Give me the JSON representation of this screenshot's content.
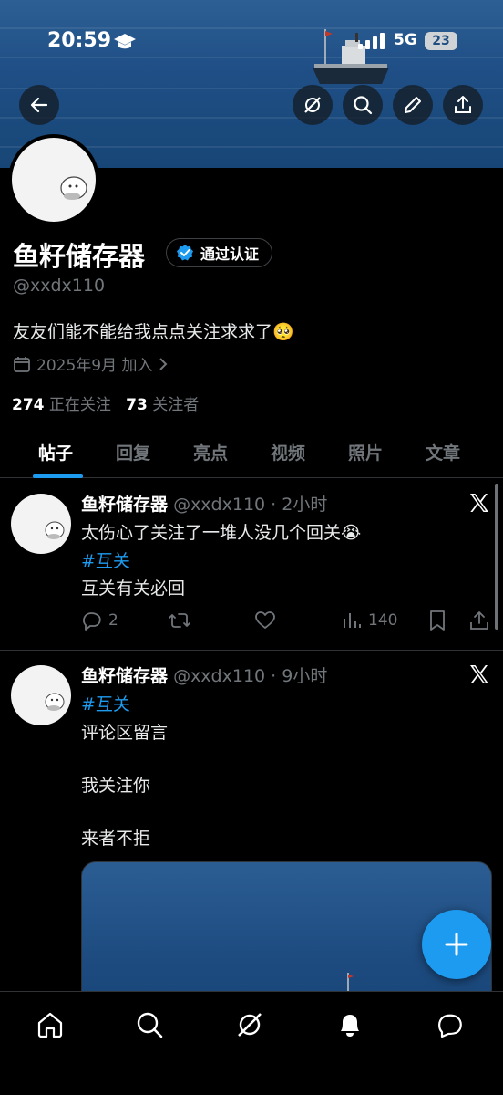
{
  "status_bar": {
    "time": "20:59",
    "network": "5G",
    "battery": "23"
  },
  "header": {
    "back_icon": "arrow-left-icon",
    "actions": [
      "grok-icon",
      "search-icon",
      "edit-icon",
      "share-icon"
    ]
  },
  "profile": {
    "name": "鱼籽储存器",
    "verified_label": "通过认证",
    "handle": "@xxdx110",
    "bio": "友友们能不能给我点点关注求求了🥺",
    "joined": "2025年9月 加入",
    "following_count": "274",
    "following_label": "正在关注",
    "followers_count": "73",
    "followers_label": "关注者"
  },
  "tabs": [
    {
      "label": "帖子",
      "active": true
    },
    {
      "label": "回复"
    },
    {
      "label": "亮点"
    },
    {
      "label": "视频"
    },
    {
      "label": "照片"
    },
    {
      "label": "文章"
    }
  ],
  "posts": [
    {
      "author": "鱼籽储存器",
      "meta": "@xxdx110 · 2小时",
      "lines": [
        "太伤心了关注了一堆人没几个回关😭",
        "#互关",
        "互关有关必回"
      ],
      "replies": "2",
      "views": "140"
    },
    {
      "author": "鱼籽储存器",
      "meta": "@xxdx110 · 9小时",
      "lines": [
        "#互关",
        "评论区留言",
        "我关注你",
        "来者不拒"
      ]
    }
  ],
  "fab": {
    "label": "+"
  },
  "bottom_nav": [
    "home-icon",
    "search-icon",
    "grok-icon",
    "notifications-icon",
    "messages-icon"
  ],
  "colors": {
    "accent": "#1d9bf0",
    "background": "#000000",
    "muted": "#71767b"
  }
}
